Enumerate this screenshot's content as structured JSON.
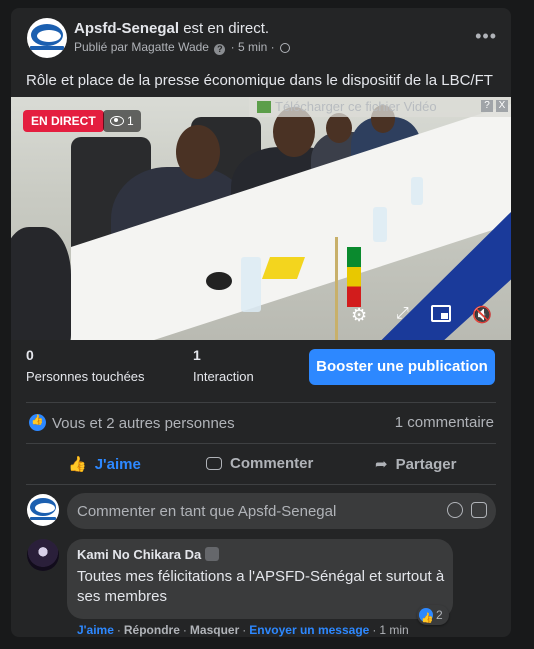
{
  "post": {
    "page_name": "Apsfd-Senegal",
    "live_suffix": "est en direct.",
    "published_by": "Publié par Magatte Wade",
    "time": "5 min",
    "more_label": "•••",
    "text": "Rôle et place de la presse économique dans le dispositif de la LBC/FT"
  },
  "video": {
    "live_badge": "EN DIRECT",
    "viewer_count": "1",
    "download_banner": "Télécharger ce fichier Vidéo",
    "download_help": "?",
    "download_close": "X",
    "controls": [
      "settings-icon",
      "fullscreen-icon",
      "pip-icon",
      "mute-icon"
    ]
  },
  "stats": {
    "reach_value": "0",
    "reach_label": "Personnes touchées",
    "engagement_value": "1",
    "engagement_label": "Interaction",
    "boost_label": "Booster une publication"
  },
  "reactions": {
    "summary": "Vous et 2 autres personnes",
    "comment_count": "1 commentaire"
  },
  "actions": {
    "like": "J'aime",
    "comment": "Commenter",
    "share": "Partager"
  },
  "composer": {
    "placeholder": "Commenter en tant que Apsfd-Senegal"
  },
  "comment": {
    "author": "Kami No Chikara Da",
    "text": "Toutes mes félicitations a l'APSFD-Sénégal et surtout à ses membres",
    "like_count": "2",
    "like_label": "J'aime",
    "reply_label": "Répondre",
    "hide_label": "Masquer",
    "message_label": "Envoyer un message",
    "time": "1 min"
  },
  "colors": {
    "accent": "#2d88ff",
    "live": "#e41e3f",
    "card": "#242526",
    "background": "#18191a"
  }
}
